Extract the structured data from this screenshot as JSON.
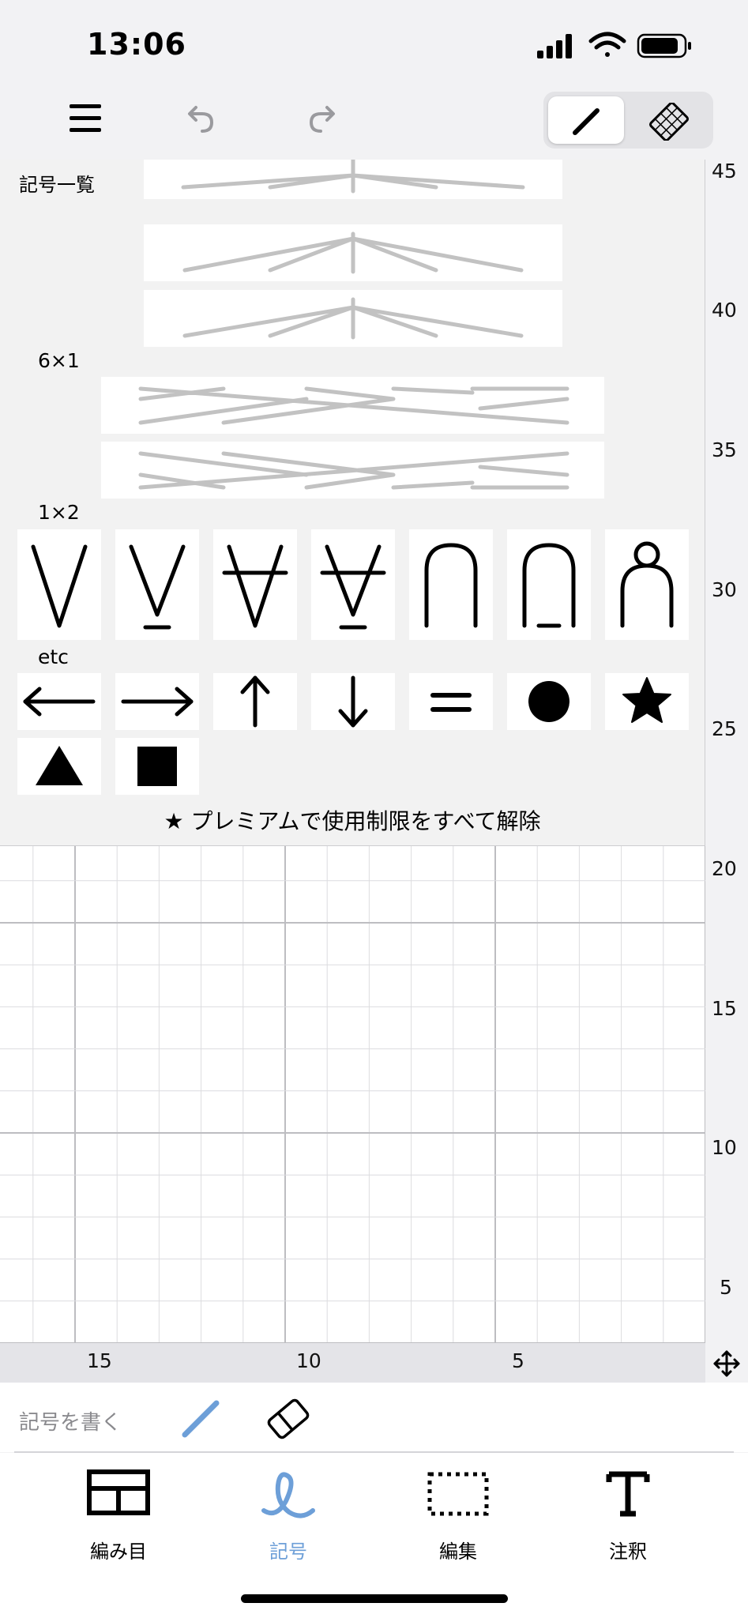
{
  "status_bar": {
    "time": "13:06"
  },
  "panel": {
    "title": "記号一覧",
    "section_labels": [
      "6×1",
      "1×2",
      "etc"
    ],
    "premium_text": "★ プレミアムで使用制限をすべて解除",
    "symbols_1x2": [
      "v-stitch-icon",
      "v-stitch-underline-icon",
      "v-stitch-bar-icon",
      "v-stitch-bar-underline-icon",
      "arch-icon",
      "arch-underline-icon",
      "arch-loop-icon"
    ],
    "symbols_etc": [
      "arrow-left-icon",
      "arrow-right-icon",
      "arrow-up-icon",
      "arrow-down-icon",
      "equals-icon",
      "circle-icon",
      "star-icon",
      "triangle-icon",
      "square-icon"
    ]
  },
  "ruler": {
    "vertical": [
      "45",
      "40",
      "35",
      "30",
      "25",
      "20",
      "15",
      "10",
      "5"
    ],
    "horizontal": [
      "15",
      "10",
      "5"
    ]
  },
  "draw_bar": {
    "label": "記号を書く"
  },
  "tabs": [
    {
      "label": "編み目",
      "icon": "grid-icon"
    },
    {
      "label": "記号",
      "icon": "loop-icon",
      "active_color": "#6d9fd8"
    },
    {
      "label": "編集",
      "icon": "dashed-rect-icon"
    },
    {
      "label": "注釈",
      "icon": "text-t-icon"
    }
  ]
}
